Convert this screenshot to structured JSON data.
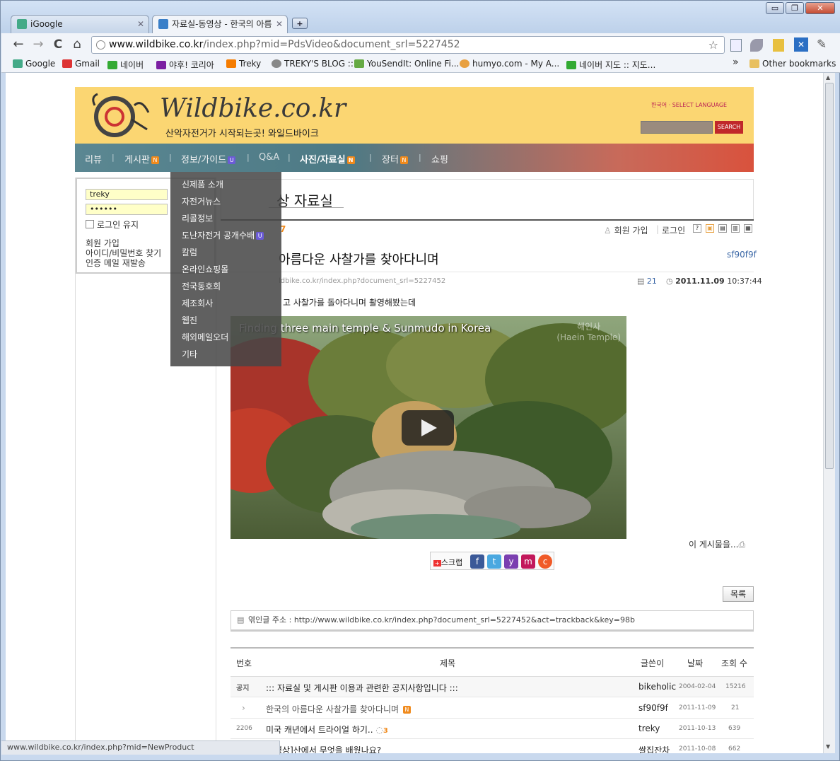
{
  "browser": {
    "tabs": [
      {
        "label": "iGoogle",
        "active": false
      },
      {
        "label": "자료실-동영상 - 한국의 아름",
        "active": true
      }
    ],
    "url_host": "www.wildbike.co.kr",
    "url_path": "/index.php?mid=PdsVideo&document_srl=5227452",
    "bookmarks": [
      "Google",
      "Gmail",
      "네이버",
      "야후! 코리아",
      "Treky",
      "TREKY'S BLOG ::",
      "YouSendIt: Online Fi...",
      "humyo.com - My A...",
      "네이버 지도 :: 지도...",
      "Other bookmarks"
    ],
    "overflow_chevron": "»",
    "window_buttons": {
      "min": "▭",
      "max": "❐",
      "close": "✕"
    },
    "new_tab": "+",
    "nav": {
      "back": "←",
      "forward": "→",
      "reload": "C",
      "home": "⌂"
    },
    "status_url": "www.wildbike.co.kr/index.php?mid=NewProduct"
  },
  "site": {
    "logo": "Wildbike.co.kr",
    "slogan": "산악자전거가 시작되는곳! 와일드바이크",
    "language": "한국어 · SELECT LANGUAGE",
    "search_button": "SEARCH",
    "nav": [
      "리뷰",
      "게시판",
      "정보/가이드",
      "Q&A",
      "사진/자료실",
      "장터",
      "쇼핑"
    ],
    "badges": {
      "new": "N",
      "updated": "U"
    }
  },
  "dropdown": [
    "신제품 소개",
    "자전거뉴스",
    "리콜정보",
    "도난자전거 공개수배",
    "칼럼",
    "온라인쇼핑몰",
    "전국동호회",
    "제조회사",
    "웹진",
    "해외메일오더",
    "기타"
  ],
  "login": {
    "user_id": "treky",
    "password": "••••••",
    "remember": "로그인 유지",
    "links": [
      "회원 가입",
      "아이디/비밀번호 찾기",
      "인증 메일 재발송"
    ]
  },
  "board": {
    "title": "상 자료실",
    "count_fragment": "7",
    "member_links": [
      "회원 가입",
      "로그인"
    ],
    "view_icons": [
      "?",
      "▣",
      "▤",
      "▥",
      "▦"
    ]
  },
  "post": {
    "title": "아름다운 사찰가를 찾아다니며",
    "author": "sf90f9f",
    "url": "ldbike.co.kr/index.php?document_srl=5227452",
    "reads": "21",
    "date": "2011.11.09",
    "time": "10:37:44",
    "body": "고 사찰가를 돌아다니며 촬영해봤는데",
    "video_title": "Finding three main temple & Sunmudo in Korea",
    "video_watermark": "해인사\n(Haein Temple)",
    "more_link": "이 게시물을...",
    "scrap_label": "스크랩",
    "list_button": "목록",
    "trackback_label": "엮인글 주소 :",
    "trackback_url": "http://www.wildbike.co.kr/index.php?document_srl=5227452&act=trackback&key=98b"
  },
  "table": {
    "headers": [
      "번호",
      "제목",
      "글쓴이",
      "날짜",
      "조회 수"
    ],
    "rows": [
      {
        "no": "공지",
        "title": "::: 자료실 및 게시판 이용과 관련한 공지사항입니다 :::",
        "author": "bikeholic",
        "date": "2004-02-04",
        "views": "15216"
      },
      {
        "no": "›",
        "title": "한국의 아름다운 사찰가를 찾아다니며",
        "author": "sf90f9f",
        "date": "2011-11-09",
        "views": "21"
      },
      {
        "no": "2206",
        "title": "미국 캐년에서 트라이얼 하기..",
        "comments": "3",
        "author": "treky",
        "date": "2011-10-13",
        "views": "639"
      },
      {
        "no": "",
        "title": "영상]산에서 무엇을 배웠나요?",
        "author": "쌀집잔차",
        "date": "2011-10-08",
        "views": "662"
      }
    ]
  },
  "colors": {
    "header_bg": "#fbd672",
    "nav_start": "#5b8792",
    "nav_end": "#d9523d",
    "link": "#3865a5",
    "new_badge": "#f08a1c",
    "updated_badge": "#6b5bd6"
  }
}
